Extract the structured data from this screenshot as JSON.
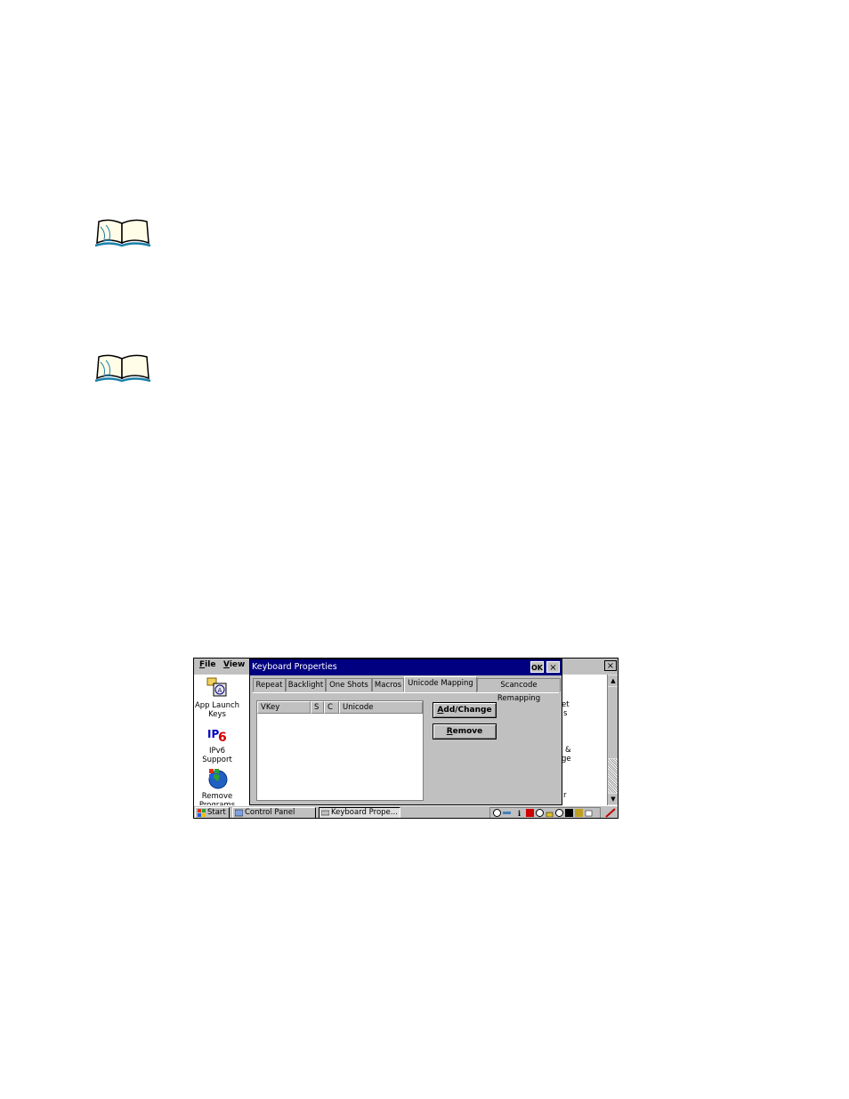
{
  "screen": {
    "menu": {
      "file": "File",
      "view": "View"
    },
    "cp_close": "×",
    "icons": [
      {
        "name": "app-launch-keys",
        "label_line1": "App Launch",
        "label_line2": "Keys"
      },
      {
        "name": "ipv6-support",
        "label_line1": "IPv6",
        "label_line2": "Support"
      },
      {
        "name": "remove-programs",
        "label_line1": "Remove",
        "label_line2": "Programs"
      }
    ],
    "right_fragments": [
      "et",
      "s",
      "&",
      "ge",
      "r"
    ],
    "dialog": {
      "title": "Keyboard Properties",
      "ok": "OK",
      "close": "×",
      "tabs": [
        "Repeat",
        "Backlight",
        "One Shots",
        "Macros",
        "Unicode Mapping",
        "Scancode Remapping"
      ],
      "active_tab": "Unicode Mapping",
      "columns": [
        "VKey",
        "S",
        "C",
        "Unicode"
      ],
      "buttons": {
        "add_change": "Add/Change",
        "remove": "Remove"
      }
    },
    "taskbar": {
      "start": "Start",
      "control_panel": "Control Panel",
      "keyboard_props": "Keyboard Prope..."
    }
  }
}
